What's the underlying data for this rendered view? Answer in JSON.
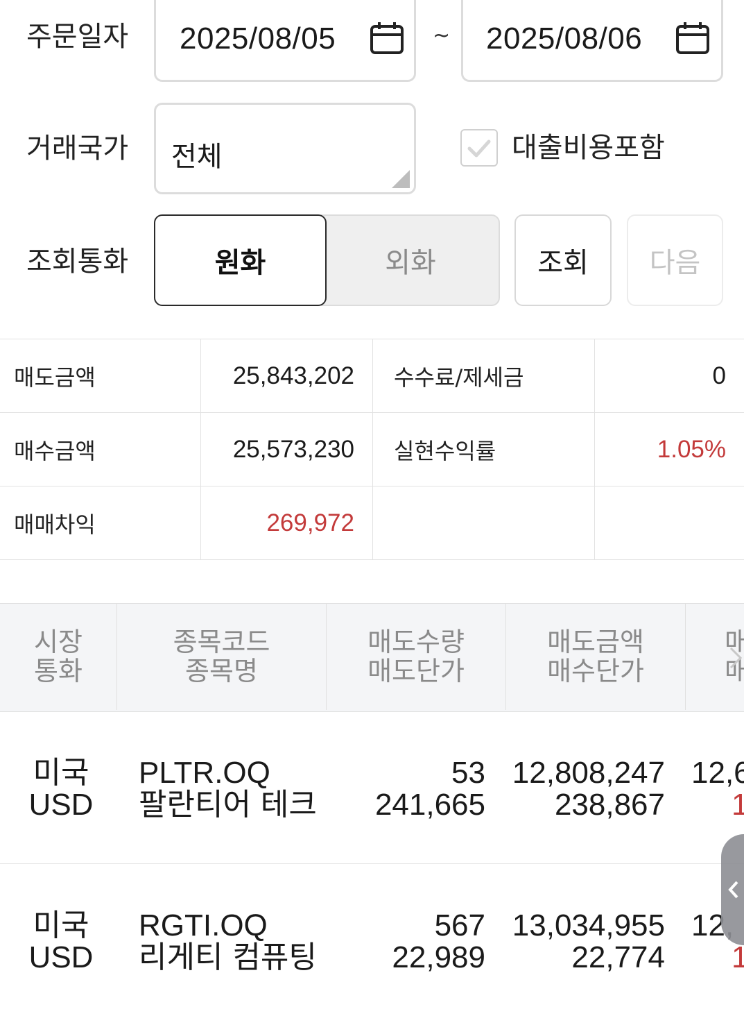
{
  "filters": {
    "order_date_label": "주문일자",
    "start_date": "2025/08/05",
    "date_separator": "~",
    "end_date": "2025/08/06",
    "country_label": "거래국가",
    "country_value": "전체",
    "include_loan_label": "대출비용포함",
    "include_loan_checked": true,
    "currency_label": "조회통화",
    "currency_krw": "원화",
    "currency_foreign": "외화",
    "search_button": "조회",
    "next_button": "다음"
  },
  "summary": {
    "sell_amount_label": "매도금액",
    "sell_amount": "25,843,202",
    "fee_tax_label": "수수료/제세금",
    "fee_tax": "0",
    "buy_amount_label": "매수금액",
    "buy_amount": "25,573,230",
    "realized_return_label": "실현수익률",
    "realized_return": "1.05%",
    "trade_profit_label": "매매차익",
    "trade_profit": "269,972"
  },
  "table": {
    "headers": [
      {
        "line1": "시장",
        "line2": "통화"
      },
      {
        "line1": "종목코드",
        "line2": "종목명"
      },
      {
        "line1": "매도수량",
        "line2": "매도단가"
      },
      {
        "line1": "매도금액",
        "line2": "매수단가"
      },
      {
        "line1": "매",
        "line2": "매"
      }
    ],
    "rows": [
      {
        "market": "미국",
        "currency": "USD",
        "code": "PLTR.OQ",
        "name": "팔란티어 테크",
        "sell_qty": "53",
        "sell_price": "241,665",
        "sell_amount": "12,808,247",
        "buy_price": "238,867",
        "partial_top": "12,6",
        "partial_bottom": "1"
      },
      {
        "market": "미국",
        "currency": "USD",
        "code": "RGTI.OQ",
        "name": "리게티 컴퓨팅",
        "sell_qty": "567",
        "sell_price": "22,989",
        "sell_amount": "13,034,955",
        "buy_price": "22,774",
        "partial_top": "12,",
        "partial_bottom": "1"
      }
    ]
  },
  "colors": {
    "profit_red": "#c33a3a",
    "border": "#dcdcdc",
    "header_bg": "#f4f5f7"
  }
}
